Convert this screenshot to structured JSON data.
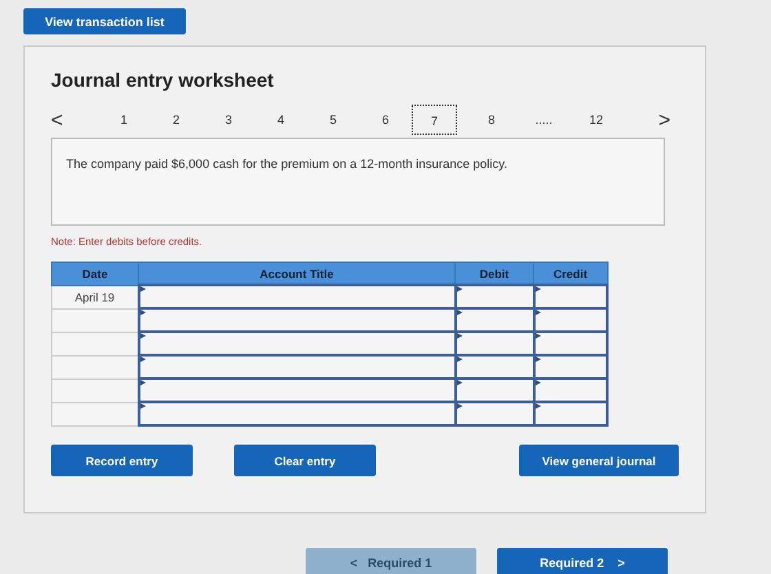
{
  "top_button": "View transaction list",
  "worksheet": {
    "title": "Journal entry worksheet",
    "prev": "<",
    "next": ">",
    "pages": [
      {
        "label": "1",
        "selected": false
      },
      {
        "label": "2",
        "selected": false
      },
      {
        "label": "3",
        "selected": false
      },
      {
        "label": "4",
        "selected": false
      },
      {
        "label": "5",
        "selected": false
      },
      {
        "label": "6",
        "selected": false
      },
      {
        "label": "7",
        "selected": true
      },
      {
        "label": "8",
        "selected": false
      },
      {
        "label": ".....",
        "selected": false
      },
      {
        "label": "12",
        "selected": false
      }
    ],
    "question": "The company paid $6,000 cash for the premium on a 12-month insurance policy.",
    "note": "Note: Enter debits before credits.",
    "table": {
      "columns": [
        "Date",
        "Account Title",
        "Debit",
        "Credit"
      ],
      "rows": [
        {
          "date": "April 19"
        },
        {},
        {},
        {},
        {},
        {}
      ]
    },
    "buttons": [
      "Record entry",
      "Clear entry",
      "View general journal"
    ]
  },
  "nav": [
    {
      "kind": "prev",
      "label": "Required 1",
      "arrow": "<",
      "disabled": true
    },
    {
      "kind": "next",
      "label": "Required 2",
      "arrow": ">",
      "disabled": false
    }
  ]
}
